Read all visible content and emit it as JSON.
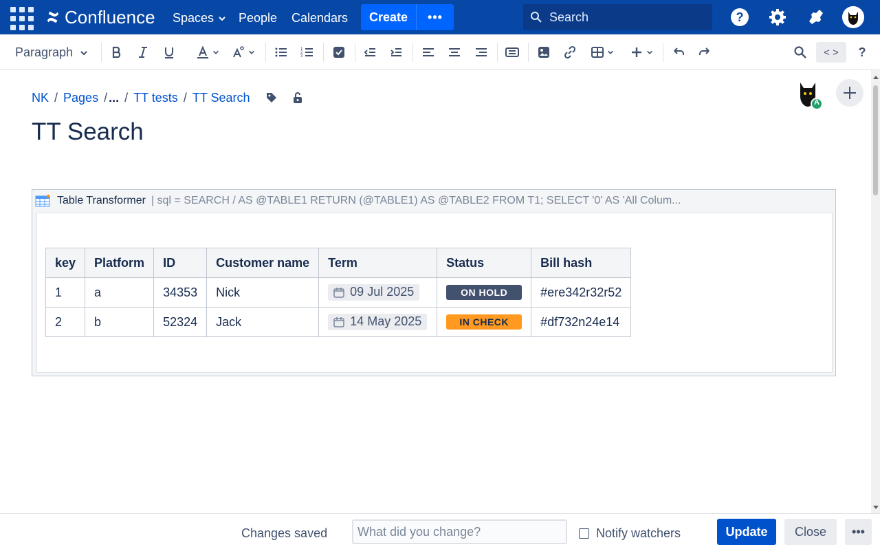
{
  "topnav": {
    "app_name": "Confluence",
    "items": [
      {
        "label": "Spaces",
        "has_dropdown": true
      },
      {
        "label": "People"
      },
      {
        "label": "Calendars"
      }
    ],
    "create_label": "Create",
    "more_label": "•••",
    "search_placeholder": "Search",
    "icons": [
      "app-switcher-icon",
      "confluence-logo-icon",
      "help-icon",
      "settings-icon",
      "notifications-icon",
      "user-avatar"
    ],
    "brand_color": "#0747a6",
    "create_color": "#0065ff"
  },
  "toolbar": {
    "paragraph_label": "Paragraph",
    "source_label": "< >",
    "help_label": "?"
  },
  "breadcrumb": {
    "items": [
      "NK",
      "Pages",
      "...",
      "TT tests",
      "TT Search"
    ]
  },
  "page": {
    "title": "TT Search",
    "avatar_badge": "A"
  },
  "macro": {
    "name": "Table Transformer",
    "params": "| sql = SEARCH / AS @TABLE1 RETURN (@TABLE1) AS @TABLE2 FROM T1; SELECT '0' AS 'All Colum..."
  },
  "table": {
    "columns": [
      "key",
      "Platform",
      "ID",
      "Customer name",
      "Term",
      "Status",
      "Bill hash"
    ],
    "rows": [
      {
        "key": "1",
        "platform": "a",
        "id": "34353",
        "customer": "Nick",
        "term": "09 Jul 2025",
        "status": "ON HOLD",
        "status_color": "#42526e",
        "bill_hash": "#ere342r32r52"
      },
      {
        "key": "2",
        "platform": "b",
        "id": "52324",
        "customer": "Jack",
        "term": "14 May 2025",
        "status": "IN CHECK",
        "status_color": "#ff991f",
        "bill_hash": "#df732n24e14"
      }
    ]
  },
  "footer": {
    "status_text": "Changes saved",
    "change_placeholder": "What did you change?",
    "notify_label": "Notify watchers",
    "notify_checked": false,
    "update_label": "Update",
    "close_label": "Close",
    "more_label": "•••"
  }
}
